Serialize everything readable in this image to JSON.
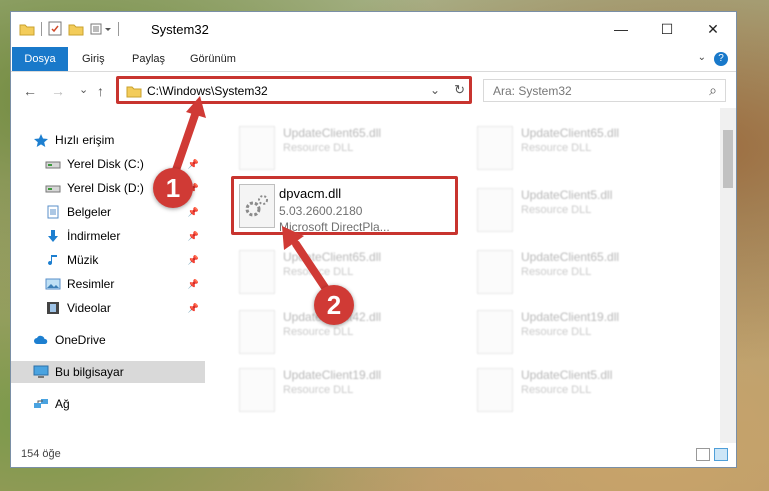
{
  "window": {
    "title": "System32",
    "minimize_glyph": "—",
    "maximize_glyph": "☐",
    "close_glyph": "✕"
  },
  "ribbon": {
    "tabs": [
      "Dosya",
      "Giriş",
      "Paylaş",
      "Görünüm"
    ],
    "help_glyph": "?",
    "collapse_glyph": "⌄"
  },
  "nav": {
    "back_glyph": "←",
    "forward_glyph": "→",
    "recent_glyph": "⌄",
    "up_glyph": "↑",
    "address": "C:\\Windows\\System32",
    "address_dropdown_glyph": "⌄",
    "refresh_glyph": "↻",
    "search_placeholder": "Ara: System32",
    "search_glyph": "⌕"
  },
  "sidebar": {
    "items": [
      {
        "label": "Hızlı erişim",
        "icon": "star-icon",
        "pinned": false
      },
      {
        "label": "Yerel Disk (C:)",
        "icon": "drive-icon",
        "pinned": true
      },
      {
        "label": "Yerel Disk (D:)",
        "icon": "drive-icon",
        "pinned": true
      },
      {
        "label": "Belgeler",
        "icon": "documents-icon",
        "pinned": true
      },
      {
        "label": "İndirmeler",
        "icon": "download-icon",
        "pinned": true
      },
      {
        "label": "Müzik",
        "icon": "music-icon",
        "pinned": true
      },
      {
        "label": "Resimler",
        "icon": "pictures-icon",
        "pinned": true
      },
      {
        "label": "Videolar",
        "icon": "videos-icon",
        "pinned": true
      },
      {
        "label": "OneDrive",
        "icon": "cloud-icon",
        "pinned": false
      },
      {
        "label": "Bu bilgisayar",
        "icon": "computer-icon",
        "pinned": false
      },
      {
        "label": "Ağ",
        "icon": "network-icon",
        "pinned": false
      }
    ],
    "pin_glyph": "📌"
  },
  "files": {
    "highlighted": {
      "name": "dpvacm.dll",
      "version": "5.03.2600.2180",
      "description": "Microsoft DirectPla..."
    },
    "blurred": [
      {
        "name": "UpdateClient65.dll",
        "desc": "Resource DLL"
      },
      {
        "name": "UpdateClient65.dll",
        "desc": "Resource DLL"
      },
      {
        "name": "UpdateClient5.dll",
        "desc": "Resource DLL"
      },
      {
        "name": "UpdateClient65.dll",
        "desc": "Resource DLL"
      },
      {
        "name": "UpdateClient65.dll",
        "desc": "Resource DLL"
      },
      {
        "name": "UpdateClient42.dll",
        "desc": "Resource DLL"
      },
      {
        "name": "UpdateClient19.dll",
        "desc": "Resource DLL"
      },
      {
        "name": "UpdateClient19.dll",
        "desc": "Resource DLL"
      },
      {
        "name": "UpdateClient5.dll",
        "desc": "Resource DLL"
      }
    ]
  },
  "status": {
    "item_count": "154 öğe"
  },
  "callouts": [
    "1",
    "2"
  ],
  "colors": {
    "accent": "#1979ca",
    "highlight": "#c8342f",
    "callout": "#d03a35"
  }
}
